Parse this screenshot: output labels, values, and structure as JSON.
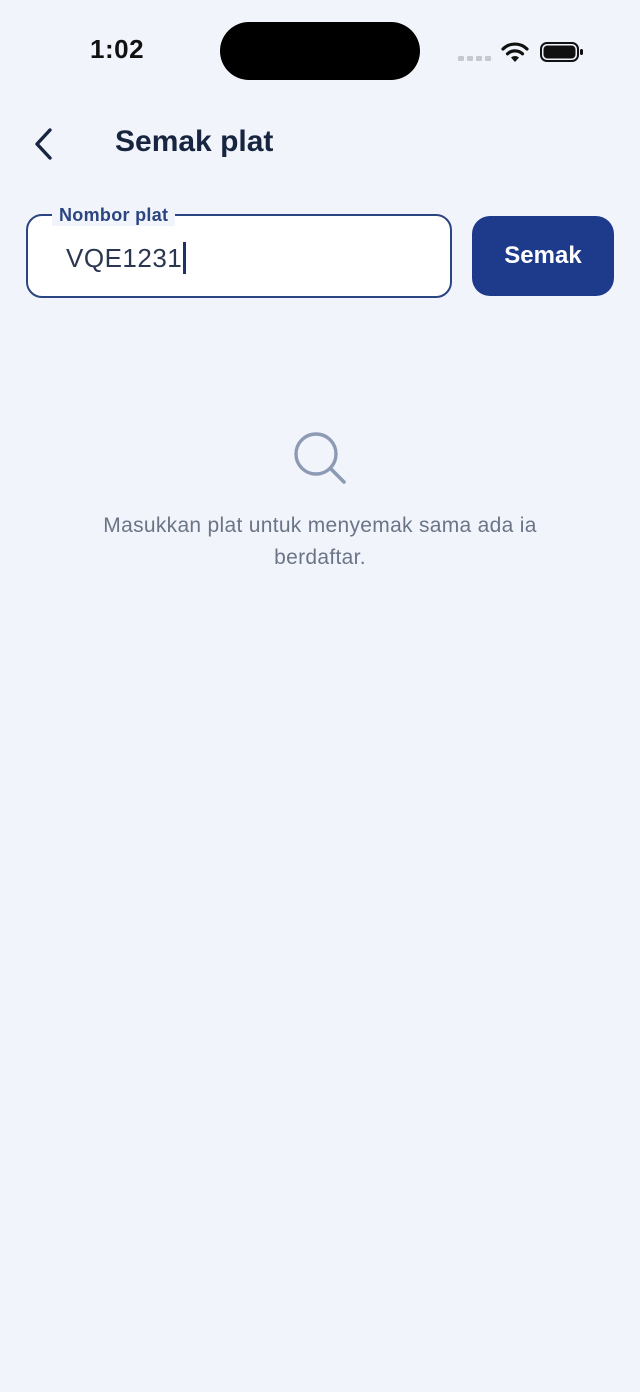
{
  "status_bar": {
    "time": "1:02"
  },
  "header": {
    "title": "Semak plat"
  },
  "plate_form": {
    "label": "Nombor plat",
    "value": "VQE1231",
    "submit_label": "Semak"
  },
  "empty_state": {
    "icon": "search-icon",
    "message": "Masukkan plat untuk menyemak sama ada ia berdaftar."
  },
  "colors": {
    "background": "#f2f4fb",
    "primary": "#1d3a8b",
    "field_border": "#2a4580",
    "muted_text": "#6b7588"
  }
}
